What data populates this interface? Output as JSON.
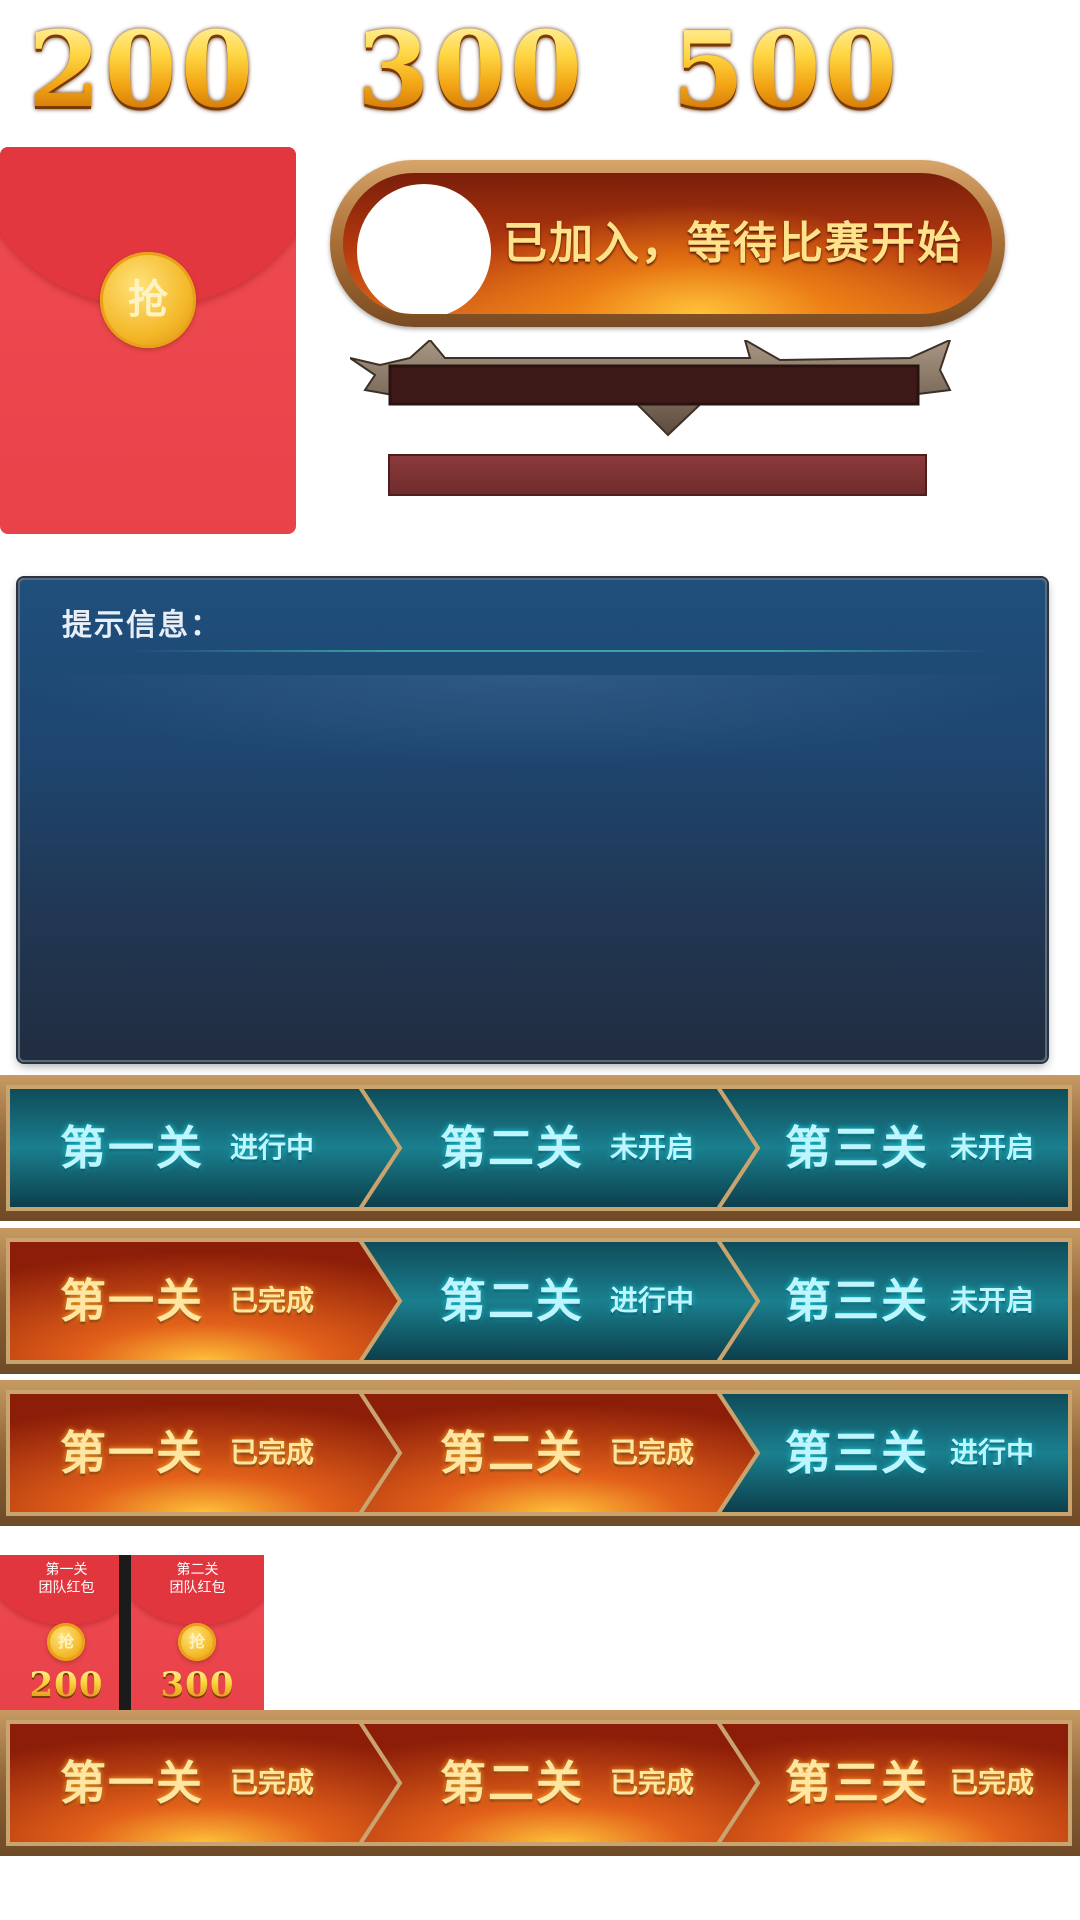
{
  "reward_amounts": [
    "200",
    "300",
    "500"
  ],
  "red_envelope": {
    "coin_label": "抢"
  },
  "join_status": {
    "text": "已加入，等待比赛开始"
  },
  "tip_panel": {
    "title": "提示信息："
  },
  "stage_bars": [
    {
      "stages": [
        {
          "name": "第一关",
          "status": "进行中",
          "style": "teal"
        },
        {
          "name": "第二关",
          "status": "未开启",
          "style": "teal"
        },
        {
          "name": "第三关",
          "status": "未开启",
          "style": "teal"
        }
      ]
    },
    {
      "stages": [
        {
          "name": "第一关",
          "status": "已完成",
          "style": "fire"
        },
        {
          "name": "第二关",
          "status": "进行中",
          "style": "teal"
        },
        {
          "name": "第三关",
          "status": "未开启",
          "style": "teal"
        }
      ]
    },
    {
      "stages": [
        {
          "name": "第一关",
          "status": "已完成",
          "style": "fire"
        },
        {
          "name": "第二关",
          "status": "已完成",
          "style": "fire"
        },
        {
          "name": "第三关",
          "status": "进行中",
          "style": "teal"
        }
      ]
    },
    {
      "stages": [
        {
          "name": "第一关",
          "status": "已完成",
          "style": "fire"
        },
        {
          "name": "第二关",
          "status": "已完成",
          "style": "fire"
        },
        {
          "name": "第三关",
          "status": "已完成",
          "style": "fire"
        }
      ]
    }
  ],
  "team_envelopes": [
    {
      "line1": "第一关",
      "line2": "团队红包",
      "coin_label": "抢",
      "amount": "200"
    },
    {
      "line1": "第二关",
      "line2": "团队红包",
      "coin_label": "抢",
      "amount": "300"
    }
  ]
}
